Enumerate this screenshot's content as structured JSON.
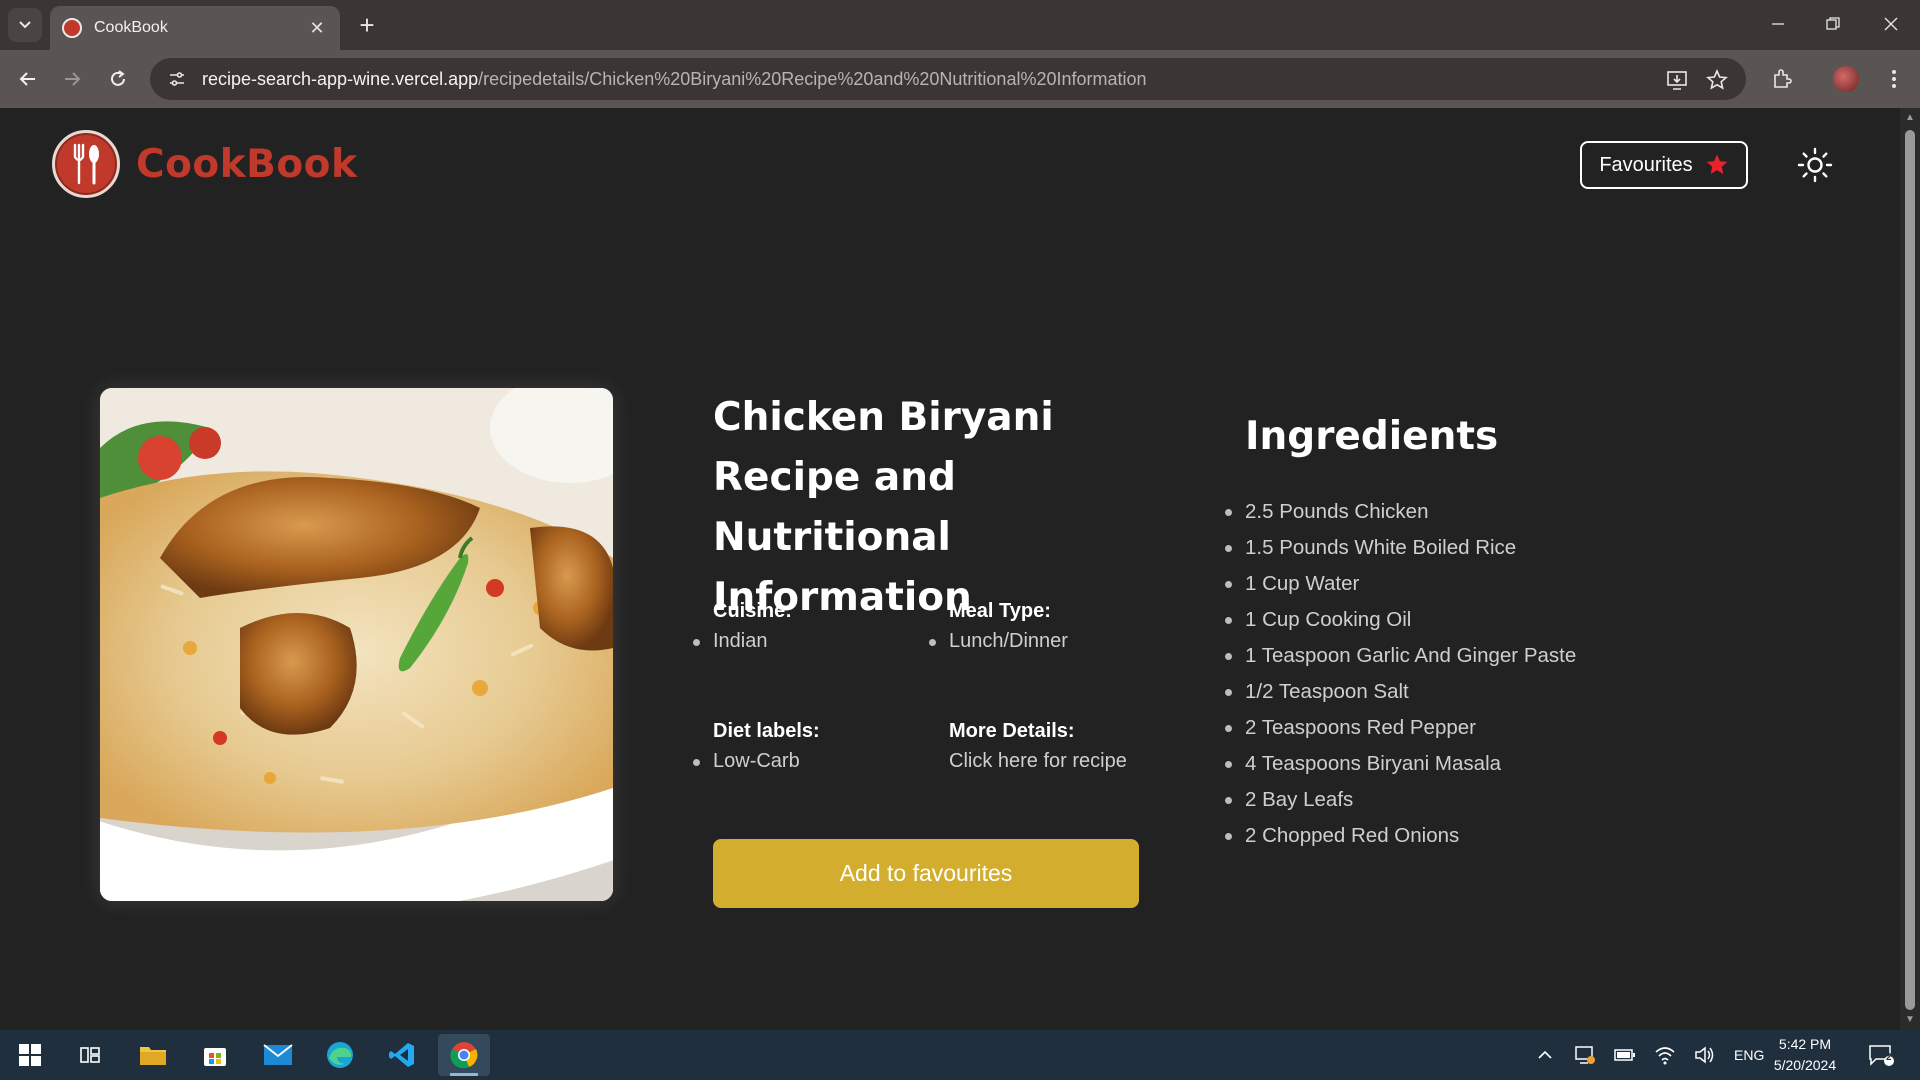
{
  "browser": {
    "tab_title": "CookBook",
    "tab_close": "✕",
    "new_tab": "+",
    "url_host": "recipe-search-app-wine.vercel.app",
    "url_path": "/recipedetails/Chicken%20Biryani%20Recipe%20and%20Nutritional%20Information"
  },
  "header": {
    "brand": "CookBook",
    "favourites_label": "Favourites",
    "brand_color": "#c0392b",
    "star_color": "#e8232c"
  },
  "recipe": {
    "title": "Chicken Biryani Recipe and Nutritional Information",
    "cuisine_label": "Cuisine:",
    "cuisine_value": "Indian",
    "meal_type_label": "Meal Type:",
    "meal_type_value": "Lunch/Dinner",
    "diet_label": "Diet labels:",
    "diet_value": "Low-Carb",
    "more_details_label": "More Details:",
    "more_details_link": "Click here for recipe",
    "add_button": "Add to favourites",
    "button_color": "#d3ae2e"
  },
  "ingredients": {
    "title": "Ingredients",
    "items": [
      "2.5 Pounds Chicken",
      "1.5 Pounds White Boiled Rice",
      "1 Cup Water",
      "1 Cup Cooking Oil",
      "1 Teaspoon Garlic And Ginger Paste",
      "1/2 Teaspoon Salt",
      "2 Teaspoons Red Pepper",
      "4 Teaspoons Biryani Masala",
      "2 Bay Leafs",
      "2 Chopped Red Onions"
    ]
  },
  "taskbar": {
    "language": "ENG",
    "time": "5:42 PM",
    "date": "5/20/2024",
    "notification_count": "2"
  }
}
